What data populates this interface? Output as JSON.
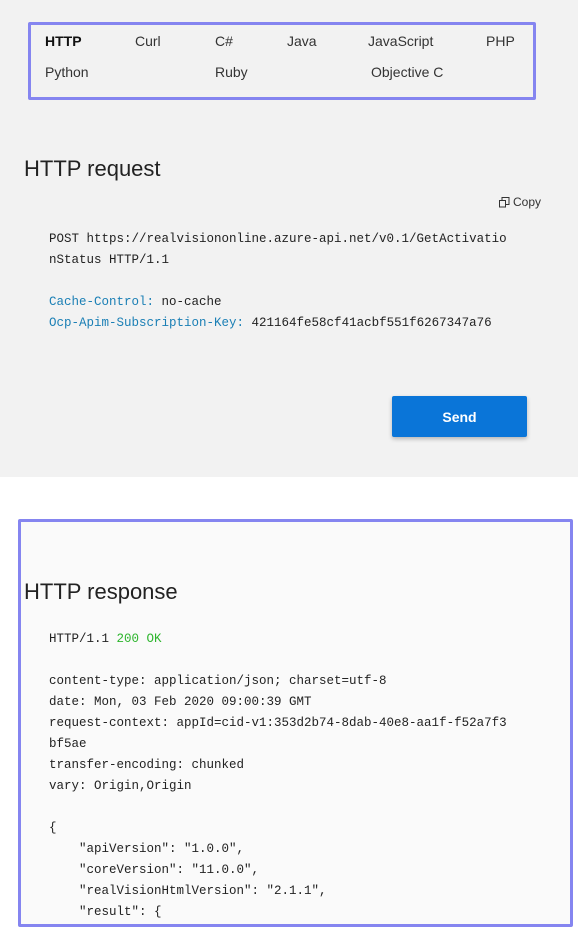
{
  "language_tabs": [
    {
      "label": "HTTP",
      "active": true
    },
    {
      "label": "Curl",
      "active": false
    },
    {
      "label": "C#",
      "active": false
    },
    {
      "label": "Java",
      "active": false
    },
    {
      "label": "JavaScript",
      "active": false
    },
    {
      "label": "PHP",
      "active": false
    },
    {
      "label": "Python",
      "active": false
    },
    {
      "label": "Ruby",
      "active": false
    },
    {
      "label": "Objective C",
      "active": false
    }
  ],
  "request": {
    "title": "HTTP request",
    "copy_label": "Copy",
    "line1": "POST https://realvisiononline.azure-api.net/v0.1/GetActivatio",
    "line2": "nStatus HTTP/1.1",
    "headers": [
      {
        "key": "Cache-Control:",
        "value": " no-cache"
      },
      {
        "key": "Ocp-Apim-Subscription-Key:",
        "value": " 421164fe58cf41acbf551f6267347a76"
      }
    ],
    "send_label": "Send"
  },
  "response": {
    "title": "HTTP response",
    "status_prefix": "HTTP/1.1 ",
    "status": "200 OK",
    "lines": [
      "content-type: application/json; charset=utf-8",
      "date: Mon, 03 Feb 2020 09:00:39 GMT",
      "request-context: appId=cid-v1:353d2b74-8dab-40e8-aa1f-f52a7f3",
      "bf5ae",
      "transfer-encoding: chunked",
      "vary: Origin,Origin",
      "",
      "{",
      "    \"apiVersion\": \"1.0.0\",",
      "    \"coreVersion\": \"11.0.0\",",
      "    \"realVisionHtmlVersion\": \"2.1.1\",",
      "    \"result\": {"
    ]
  },
  "colors": {
    "accent": "#0a75d8",
    "header_key": "#1a7fb5",
    "status_ok": "#2db52d",
    "highlight_border": "#8585f0"
  }
}
